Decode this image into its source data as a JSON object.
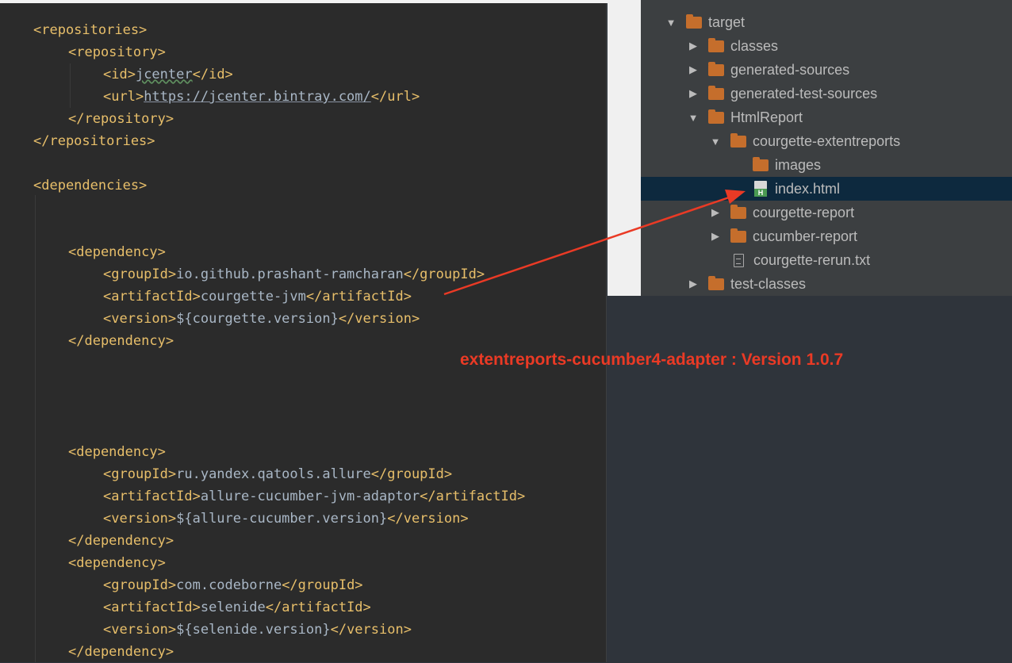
{
  "editor": {
    "lines": {
      "l1": {
        "open": "<repositories>"
      },
      "l2": {
        "open": "<repository>"
      },
      "l3": {
        "open": "<id>",
        "text": "jcenter",
        "close": "</id>"
      },
      "l4": {
        "open": "<url>",
        "text": "https://jcenter.bintray.com/",
        "close": "</url>"
      },
      "l5": {
        "close": "</repository>"
      },
      "l6": {
        "close": "</repositories>"
      },
      "l7": {
        "open": "<dependencies>"
      },
      "l8": {
        "open": "<dependency>"
      },
      "l9": {
        "open": "<groupId>",
        "text": "io.github.prashant-ramcharan",
        "close": "</groupId>"
      },
      "l10": {
        "open": "<artifactId>",
        "text": "courgette-jvm",
        "close": "</artifactId>"
      },
      "l11": {
        "open": "<version>",
        "text": "${courgette.version}",
        "close": "</version>"
      },
      "l12": {
        "close": "</dependency>"
      },
      "l13": {
        "open": "<dependency>"
      },
      "l14": {
        "open": "<groupId>",
        "text": "ru.yandex.qatools.allure",
        "close": "</groupId>"
      },
      "l15": {
        "open": "<artifactId>",
        "text": "allure-cucumber-jvm-adaptor",
        "close": "</artifactId>"
      },
      "l16": {
        "open": "<version>",
        "text": "${allure-cucumber.version}",
        "close": "</version>"
      },
      "l17": {
        "close": "</dependency>"
      },
      "l18": {
        "open": "<dependency>"
      },
      "l19": {
        "open": "<groupId>",
        "text": "com.codeborne",
        "close": "</groupId>"
      },
      "l20": {
        "open": "<artifactId>",
        "text": "selenide",
        "close": "</artifactId>"
      },
      "l21": {
        "open": "<version>",
        "text": "${selenide.version}",
        "close": "</version>"
      },
      "l22": {
        "close": "</dependency>"
      }
    }
  },
  "tree": {
    "items": [
      {
        "label": "target",
        "icon": "folder-icon",
        "arrow": "▼"
      },
      {
        "label": "classes",
        "icon": "folder-icon",
        "arrow": "▶"
      },
      {
        "label": "generated-sources",
        "icon": "folder-icon",
        "arrow": "▶"
      },
      {
        "label": "generated-test-sources",
        "icon": "folder-icon",
        "arrow": "▶"
      },
      {
        "label": "HtmlReport",
        "icon": "folder-icon",
        "arrow": "▼"
      },
      {
        "label": "courgette-extentreports",
        "icon": "folder-icon",
        "arrow": "▼"
      },
      {
        "label": "images",
        "icon": "folder-icon",
        "arrow": ""
      },
      {
        "label": "index.html",
        "icon": "html-file-icon",
        "arrow": ""
      },
      {
        "label": "courgette-report",
        "icon": "folder-icon",
        "arrow": "▶"
      },
      {
        "label": "cucumber-report",
        "icon": "folder-icon",
        "arrow": "▶"
      },
      {
        "label": "courgette-rerun.txt",
        "icon": "text-file-icon",
        "arrow": ""
      },
      {
        "label": "test-classes",
        "icon": "folder-icon",
        "arrow": "▶"
      }
    ],
    "selected": "index.html"
  },
  "annotation": {
    "text": "extentreports-cucumber4-adapter : Version 1.0.7",
    "color": "#ea3a25"
  },
  "colors": {
    "tag": "#e8bf6a",
    "text": "#a9b7c6",
    "editor_bg": "#2b2b2b",
    "tree_bg": "#3c3f41",
    "selection": "#0d293e",
    "folder": "#c56e2c"
  }
}
